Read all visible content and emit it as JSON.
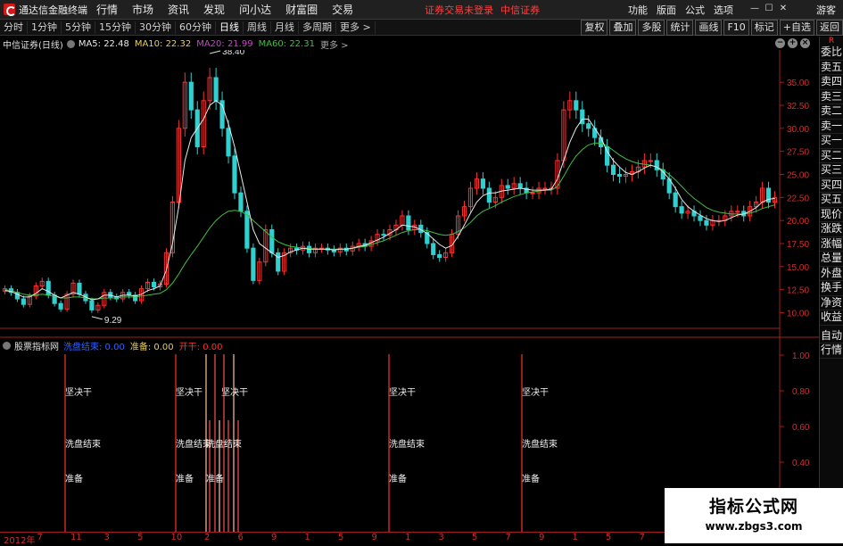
{
  "app": {
    "title": "通达信金融终端",
    "menu": [
      "行情",
      "市场",
      "资讯",
      "发现",
      "问小达",
      "财富圈",
      "交易"
    ],
    "login_tip": "证券交易未登录",
    "broker_tip": "中信证券",
    "right_menu": [
      "功能",
      "版面",
      "公式",
      "选项"
    ],
    "guest": "游客"
  },
  "toolbar": {
    "periods": [
      "分时",
      "1分钟",
      "5分钟",
      "15分钟",
      "30分钟",
      "60分钟",
      "日线",
      "周线",
      "月线",
      "多周期",
      "更多 >"
    ],
    "active_period": "日线",
    "tools": [
      "复权",
      "叠加",
      "多股",
      "统计",
      "画线",
      "F10",
      "标记",
      "+自选",
      "返回"
    ]
  },
  "chart_title": {
    "stock": "中信证券(日线)",
    "ma5": "MA5: 22.48",
    "ma10": "MA10: 22.32",
    "ma20": "MA20: 21.99",
    "ma60": "MA60: 22.31",
    "more": "更多 >"
  },
  "sidebar": {
    "mark": "R",
    "items": [
      "委比",
      "卖五",
      "卖四",
      "卖三",
      "卖二",
      "卖一",
      "买一",
      "买二",
      "买三",
      "买四",
      "买五",
      "现价",
      "涨跌",
      "涨幅",
      "总量",
      "外盘",
      "换手",
      "净资",
      "收益"
    ],
    "bottom_items": [
      "自动",
      "行情"
    ]
  },
  "indicator_title": {
    "name": "股票指标网",
    "a": "洗盘结束: 0.00",
    "b": "准备: 0.00",
    "c": "开干: 0.00"
  },
  "signals": {
    "top": "坚决干",
    "mid": "洗盘结束",
    "low": "准备"
  },
  "time_axis": [
    "2012年",
    "7",
    "11",
    "3",
    "5",
    "10",
    "2",
    "6",
    "9",
    "1",
    "5",
    "9",
    "1",
    "3",
    "5",
    "7",
    "9",
    "1",
    "5",
    "7",
    "9",
    "1",
    "3",
    "5"
  ],
  "watermark": {
    "title": "指标公式网",
    "url": "www.zbgs3.com"
  },
  "colors": {
    "up": "#ff3030",
    "down": "#30d0d0",
    "ma5": "#e8e8e8",
    "ma10": "#e8d050",
    "ma20": "#d040d0",
    "ma60": "#40c040",
    "axis": "#cc3030"
  },
  "chart_data": {
    "type": "candlestick",
    "title": "中信证券(日线)",
    "ylim": [
      8.5,
      38.5
    ],
    "yticks": [
      10.0,
      12.5,
      15.0,
      17.5,
      20.0,
      22.5,
      25.0,
      27.5,
      30.0,
      32.5,
      35.0
    ],
    "annotations": [
      {
        "label": "38.40",
        "value": 38.4
      },
      {
        "label": "9.29",
        "value": 9.29
      }
    ],
    "close_series": [
      12.6,
      12.2,
      11.5,
      10.9,
      11.8,
      12.9,
      13.4,
      11.9,
      11.0,
      10.4,
      12.0,
      13.2,
      12.0,
      11.3,
      10.3,
      10.8,
      12.2,
      11.7,
      11.5,
      12.2,
      11.9,
      11.3,
      12.6,
      13.3,
      12.8,
      13.1,
      16.5,
      22.0,
      30.0,
      35.0,
      32.0,
      28.0,
      33.0,
      35.5,
      33.0,
      30.0,
      27.0,
      23.0,
      21.0,
      17.0,
      13.5,
      15.5,
      19.0,
      16.5,
      14.5,
      16.5,
      17.0,
      16.8,
      17.2,
      16.5,
      17.0,
      17.0,
      16.8,
      16.6,
      17.0,
      16.7,
      17.2,
      17.5,
      17.2,
      17.8,
      18.5,
      18.4,
      19.0,
      19.5,
      20.5,
      19.0,
      19.5,
      18.7,
      17.5,
      16.3,
      16.0,
      16.5,
      18.5,
      20.5,
      21.5,
      23.5,
      24.5,
      23.5,
      22.0,
      22.5,
      23.8,
      23.5,
      24.0,
      23.5,
      23.0,
      23.0,
      23.5,
      23.5,
      23.5,
      26.5,
      32.0,
      33.0,
      32.0,
      30.5,
      30.0,
      29.0,
      28.0,
      26.0,
      25.0,
      24.8,
      25.0,
      25.3,
      25.8,
      26.5,
      26.5,
      25.5,
      24.5,
      23.0,
      21.5,
      20.8,
      21.0,
      20.5,
      20.0,
      19.5,
      20.0,
      20.0,
      20.5,
      21.0,
      21.0,
      20.5,
      21.5,
      22.0,
      23.5,
      22.0,
      22.5
    ],
    "ma5_series": [
      12.4,
      12.3,
      12.0,
      11.7,
      11.7,
      12.1,
      12.6,
      12.3,
      11.9,
      11.6,
      11.9,
      12.2,
      12.0,
      11.7,
      11.4,
      11.5,
      11.9,
      11.9,
      11.7,
      11.9,
      11.9,
      11.8,
      12.0,
      12.4,
      12.6,
      12.9,
      14.6,
      17.5,
      21.5,
      26.5,
      29.0,
      30.0,
      31.0,
      32.5,
      33.0,
      32.5,
      30.5,
      28.0,
      25.0,
      22.0,
      19.0,
      17.5,
      17.0,
      16.5,
      16.0,
      16.2,
      16.6,
      16.8,
      17.0,
      16.9,
      16.9,
      16.9,
      16.9,
      16.8,
      16.9,
      16.9,
      17.0,
      17.2,
      17.3,
      17.6,
      17.9,
      18.2,
      18.6,
      19.0,
      19.5,
      19.4,
      19.3,
      19.0,
      18.6,
      18.0,
      17.4,
      17.0,
      17.3,
      18.3,
      19.5,
      20.8,
      22.0,
      22.7,
      23.0,
      23.0,
      23.2,
      23.3,
      23.4,
      23.5,
      23.4,
      23.3,
      23.3,
      23.3,
      23.4,
      24.5,
      26.5,
      28.5,
      30.0,
      31.0,
      31.0,
      30.0,
      29.0,
      27.5,
      26.5,
      25.8,
      25.2,
      25.0,
      25.3,
      25.7,
      26.0,
      25.8,
      25.3,
      24.5,
      23.5,
      22.3,
      21.5,
      21.0,
      20.6,
      20.2,
      20.0,
      19.9,
      20.0,
      20.3,
      20.6,
      20.7,
      21.0,
      21.4,
      22.0,
      22.3,
      22.4
    ],
    "ma60_series": [
      12.5,
      12.4,
      12.2,
      12.0,
      11.9,
      11.9,
      12.0,
      11.9,
      11.8,
      11.6,
      11.6,
      11.7,
      11.7,
      11.6,
      11.5,
      11.5,
      11.6,
      11.6,
      11.6,
      11.7,
      11.7,
      11.7,
      11.8,
      11.9,
      12.0,
      12.1,
      12.5,
      13.2,
      14.2,
      15.3,
      16.3,
      17.2,
      18.2,
      19.2,
      20.0,
      20.6,
      21.0,
      21.1,
      21.0,
      20.6,
      20.0,
      19.4,
      18.8,
      18.2,
      17.7,
      17.4,
      17.2,
      17.1,
      17.0,
      17.0,
      16.9,
      16.9,
      16.9,
      16.9,
      16.9,
      16.9,
      17.0,
      17.1,
      17.2,
      17.4,
      17.6,
      17.8,
      18.1,
      18.4,
      18.7,
      18.9,
      19.0,
      19.0,
      18.9,
      18.7,
      18.5,
      18.4,
      18.5,
      18.8,
      19.2,
      19.8,
      20.5,
      21.0,
      21.3,
      21.6,
      22.0,
      22.3,
      22.6,
      22.8,
      23.0,
      23.1,
      23.2,
      23.3,
      23.3,
      23.7,
      24.8,
      26.0,
      27.0,
      27.7,
      28.2,
      28.4,
      28.4,
      28.1,
      27.6,
      27.1,
      26.7,
      26.4,
      26.2,
      26.1,
      26.0,
      25.8,
      25.5,
      25.0,
      24.4,
      23.7,
      23.0,
      22.4,
      21.9,
      21.4,
      21.1,
      20.9,
      20.8,
      20.7,
      20.7,
      20.7,
      20.8,
      21.0,
      21.3,
      21.5,
      21.7
    ]
  }
}
